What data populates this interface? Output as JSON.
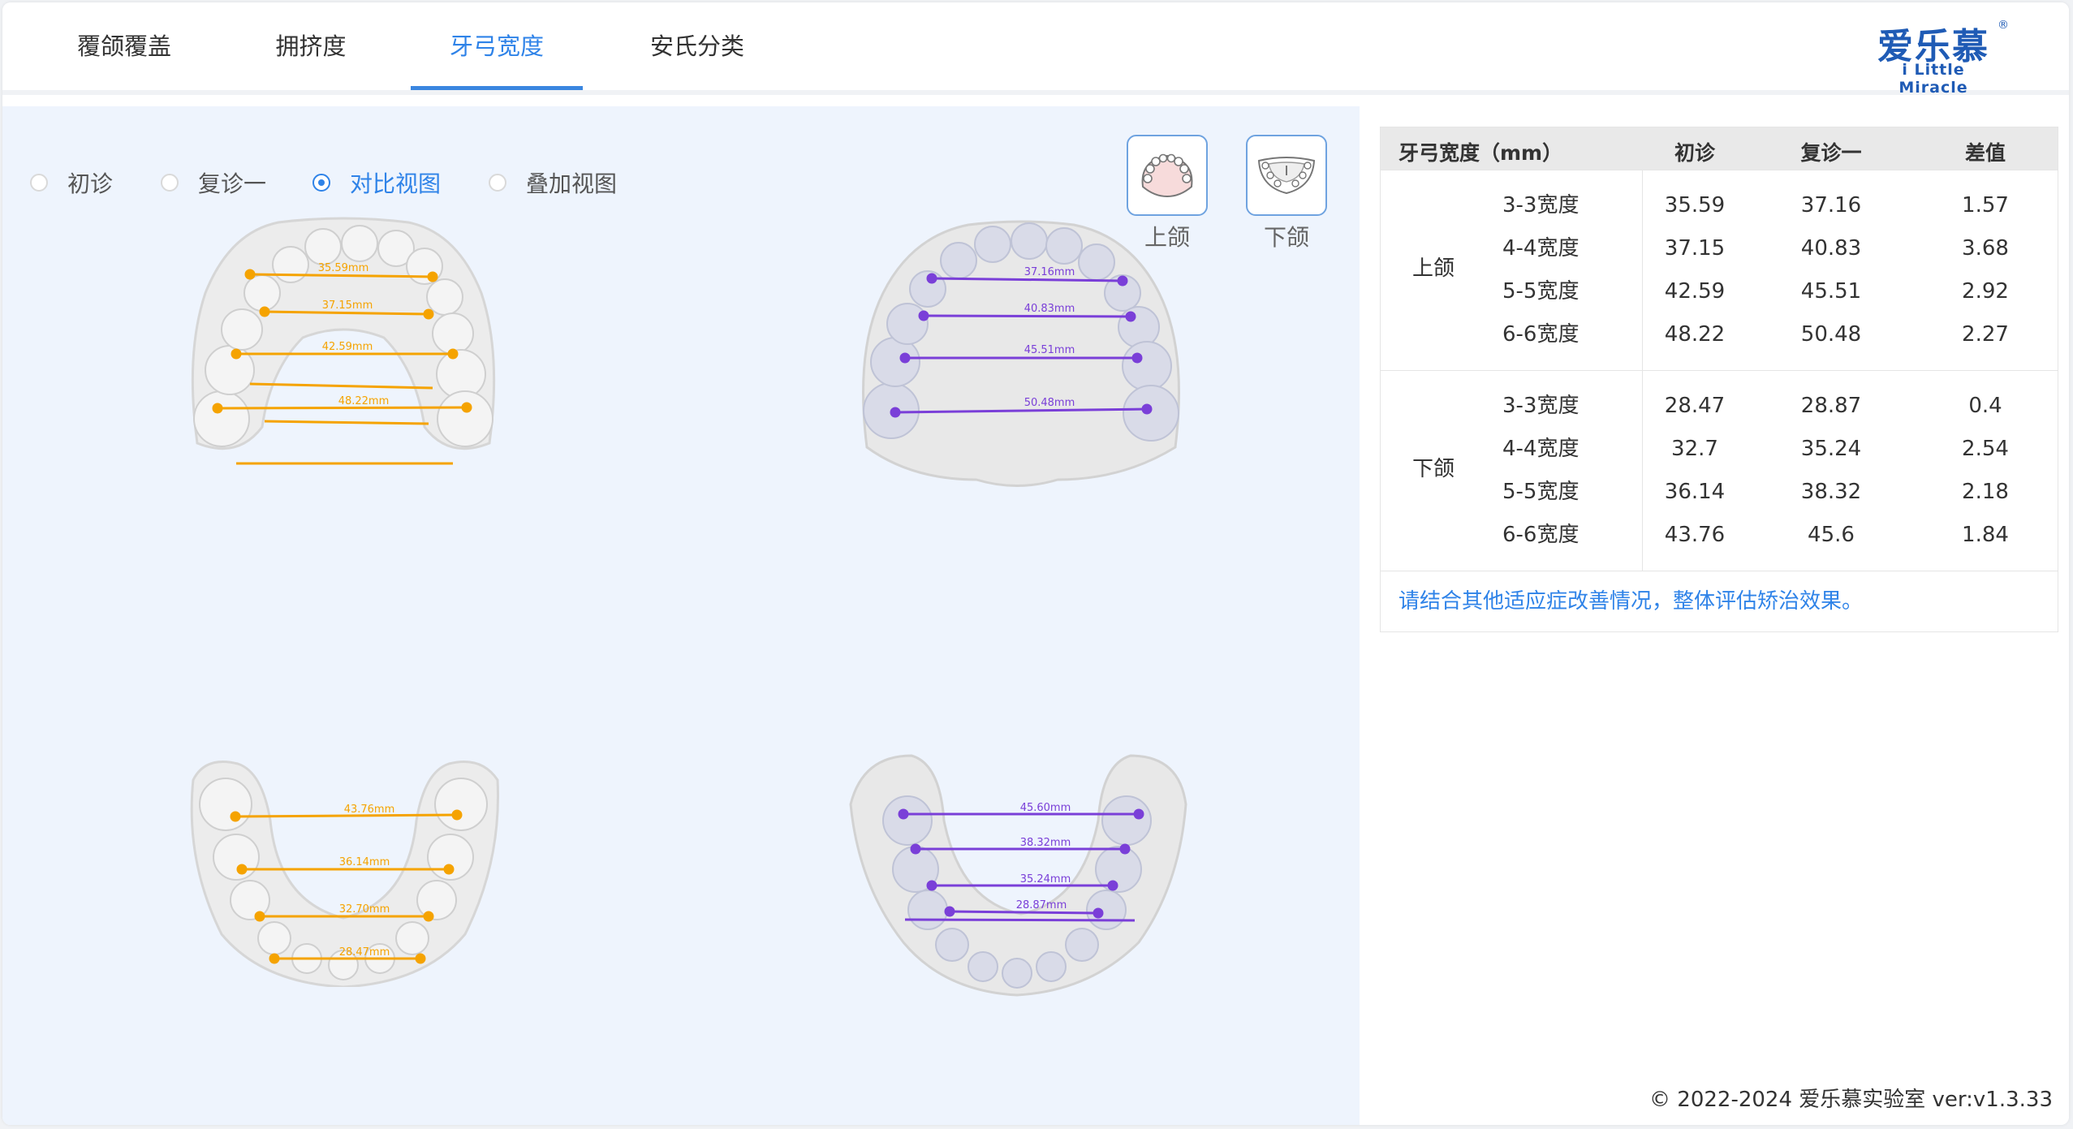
{
  "tabs": [
    {
      "label": "覆颌覆盖"
    },
    {
      "label": "拥挤度"
    },
    {
      "label": "牙弓宽度",
      "active": true
    },
    {
      "label": "安氏分类"
    }
  ],
  "logo": {
    "cn": "爱乐慕",
    "en": "i Little Miracle",
    "reg": "®"
  },
  "view_modes": [
    {
      "label": "初诊",
      "checked": false
    },
    {
      "label": "复诊一",
      "checked": false
    },
    {
      "label": "对比视图",
      "checked": true
    },
    {
      "label": "叠加视图",
      "checked": false
    }
  ],
  "jaw_buttons": {
    "upper": "上颌",
    "lower": "下颌"
  },
  "colors": {
    "accent": "#2f83e8",
    "initial_line": "#f5a300",
    "followup_line": "#7a3fd8"
  },
  "measurements": {
    "upper_initial": [
      "35.59mm",
      "37.15mm",
      "42.59mm",
      "48.22mm"
    ],
    "upper_followup": [
      "37.16mm",
      "40.83mm",
      "45.51mm",
      "50.48mm"
    ],
    "lower_initial": [
      "43.76mm",
      "36.14mm",
      "32.70mm",
      "28.47mm"
    ],
    "lower_followup": [
      "45.60mm",
      "38.32mm",
      "35.24mm",
      "28.87mm"
    ]
  },
  "table": {
    "headers": [
      "牙弓宽度（mm）",
      "初诊",
      "复诊一",
      "差值"
    ],
    "groups": [
      {
        "name": "上颌",
        "rows": [
          [
            "3-3宽度",
            "35.59",
            "37.16",
            "1.57"
          ],
          [
            "4-4宽度",
            "37.15",
            "40.83",
            "3.68"
          ],
          [
            "5-5宽度",
            "42.59",
            "45.51",
            "2.92"
          ],
          [
            "6-6宽度",
            "48.22",
            "50.48",
            "2.27"
          ]
        ]
      },
      {
        "name": "下颌",
        "rows": [
          [
            "3-3宽度",
            "28.47",
            "28.87",
            "0.4"
          ],
          [
            "4-4宽度",
            "32.7",
            "35.24",
            "2.54"
          ],
          [
            "5-5宽度",
            "36.14",
            "38.32",
            "2.18"
          ],
          [
            "6-6宽度",
            "43.76",
            "45.6",
            "1.84"
          ]
        ]
      }
    ],
    "note": "请结合其他适应症改善情况，整体评估矫治效果。"
  },
  "footer": "© 2022-2024 爱乐慕实验室 ver:v1.3.33"
}
